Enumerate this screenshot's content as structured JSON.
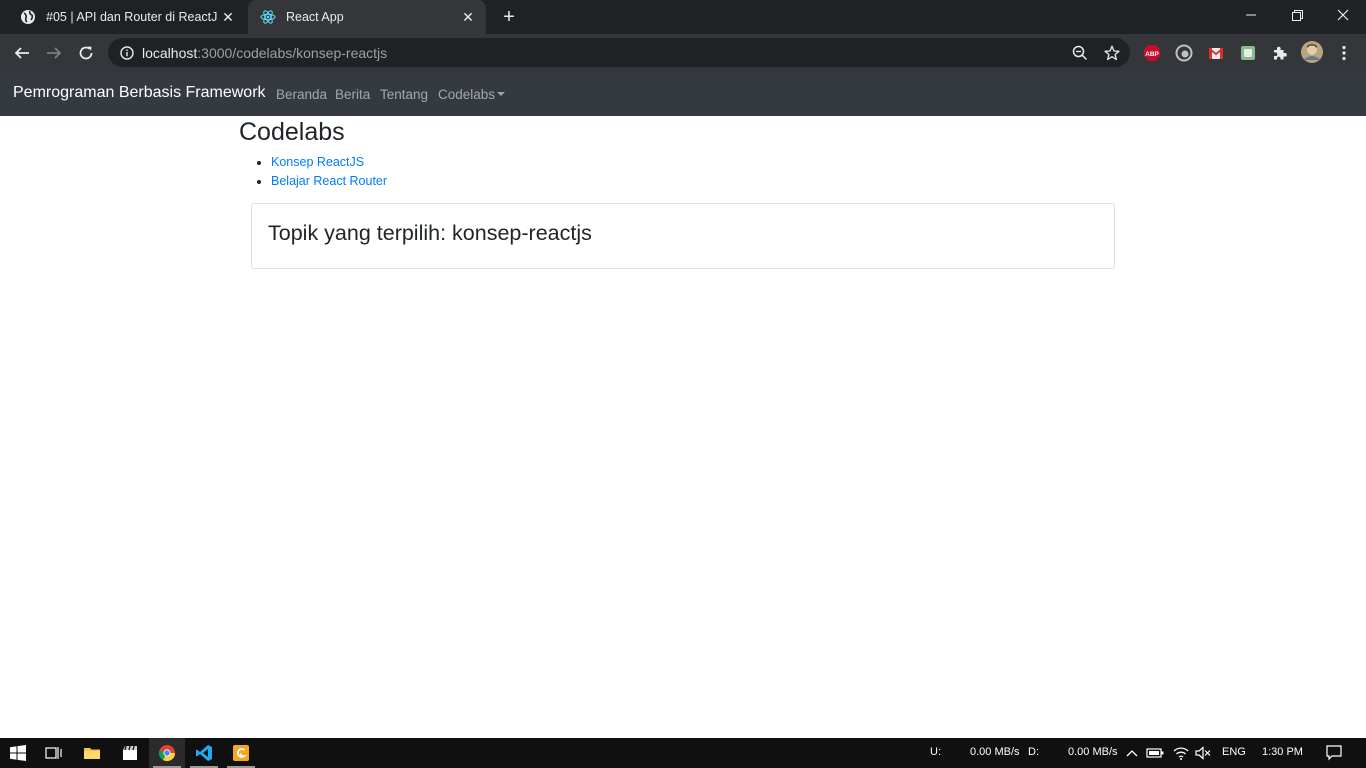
{
  "browser": {
    "tabs": [
      {
        "title": "#05 | API dan Router di ReactJs",
        "favicon": "globe-icon",
        "active": false
      },
      {
        "title": "React App",
        "favicon": "react-logo-icon",
        "active": true
      }
    ],
    "url_host": "localhost",
    "url_path": ":3000/codelabs/konsep-reactjs",
    "extensions": [
      "adblock-plus-icon",
      "edge-sync-icon",
      "mail-extension-icon",
      "note-extension-icon",
      "puzzle-extensions-icon"
    ],
    "abp_label": "ABP"
  },
  "navbar": {
    "brand": "Pemrograman Berbasis Framework",
    "links": [
      "Beranda",
      "Berita",
      "Tentang",
      "Codelabs"
    ]
  },
  "page": {
    "title": "Codelabs",
    "topics": [
      "Konsep ReactJS",
      "Belajar React Router"
    ],
    "selected_topic": "Topik yang terpilih: konsep-reactjs"
  },
  "taskbar": {
    "upload_label": "U:",
    "upload_value": "0.00 MB/s",
    "download_label": "D:",
    "download_value": "0.00 MB/s",
    "language": "ENG",
    "time": "1:30 PM"
  },
  "colors": {
    "navbar_bg": "#343a40",
    "link": "#007bff",
    "chrome_dark": "#202124",
    "chrome_toolbar": "#35363a"
  }
}
